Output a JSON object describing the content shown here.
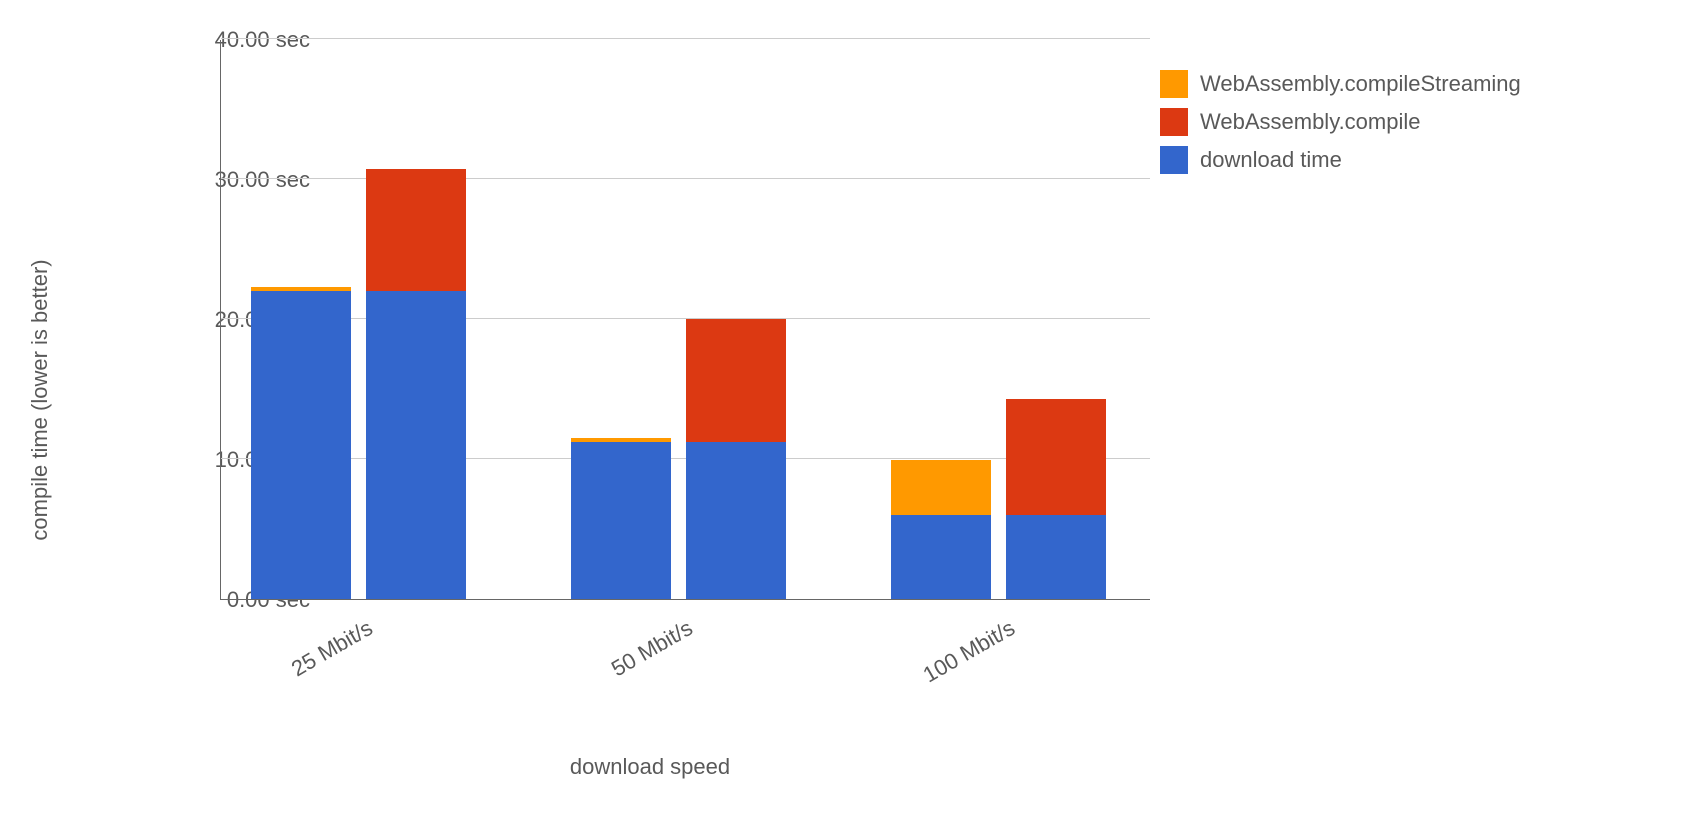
{
  "chart_data": {
    "type": "bar",
    "title": "",
    "xlabel": "download speed",
    "ylabel": "compile time (lower is better)",
    "ylim": [
      0,
      40
    ],
    "y_ticks": [
      0,
      10,
      20,
      30,
      40
    ],
    "y_tick_labels": [
      "0.00 sec",
      "10.00 sec",
      "20.00 sec",
      "30.00 sec",
      "40.00 sec"
    ],
    "categories": [
      "25 Mbit/s",
      "50 Mbit/s",
      "100 Mbit/s"
    ],
    "groups": [
      {
        "category": "25 Mbit/s",
        "bars": [
          {
            "stack": [
              {
                "series": "download time",
                "value": 22.0
              },
              {
                "series": "WebAssembly.compileStreaming",
                "value": 0.3
              }
            ]
          },
          {
            "stack": [
              {
                "series": "download time",
                "value": 22.0
              },
              {
                "series": "WebAssembly.compile",
                "value": 8.7
              }
            ]
          }
        ]
      },
      {
        "category": "50 Mbit/s",
        "bars": [
          {
            "stack": [
              {
                "series": "download time",
                "value": 11.2
              },
              {
                "series": "WebAssembly.compileStreaming",
                "value": 0.3
              }
            ]
          },
          {
            "stack": [
              {
                "series": "download time",
                "value": 11.2
              },
              {
                "series": "WebAssembly.compile",
                "value": 8.8
              }
            ]
          }
        ]
      },
      {
        "category": "100 Mbit/s",
        "bars": [
          {
            "stack": [
              {
                "series": "download time",
                "value": 6.0
              },
              {
                "series": "WebAssembly.compileStreaming",
                "value": 3.9
              }
            ]
          },
          {
            "stack": [
              {
                "series": "download time",
                "value": 6.0
              },
              {
                "series": "WebAssembly.compile",
                "value": 8.3
              }
            ]
          }
        ]
      }
    ],
    "series_colors": {
      "WebAssembly.compileStreaming": "#ff9900",
      "WebAssembly.compile": "#dc3912",
      "download time": "#3366cc"
    },
    "legend": [
      {
        "label": "WebAssembly.compileStreaming",
        "color": "#ff9900"
      },
      {
        "label": "WebAssembly.compile",
        "color": "#dc3912"
      },
      {
        "label": "download time",
        "color": "#3366cc"
      }
    ]
  }
}
